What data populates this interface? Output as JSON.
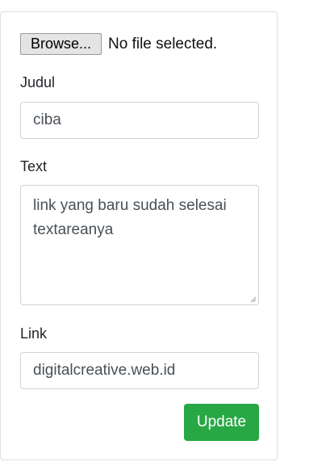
{
  "file_input": {
    "button_label": "Browse...",
    "status": "No file selected."
  },
  "judul": {
    "label": "Judul",
    "value": "ciba"
  },
  "text": {
    "label": "Text",
    "value": "link yang baru sudah selesai textareanya"
  },
  "link": {
    "label": "Link",
    "value": "digitalcreative.web.id"
  },
  "submit": {
    "label": "Update"
  },
  "colors": {
    "primary_button": "#28a745",
    "border": "#ced4da"
  }
}
